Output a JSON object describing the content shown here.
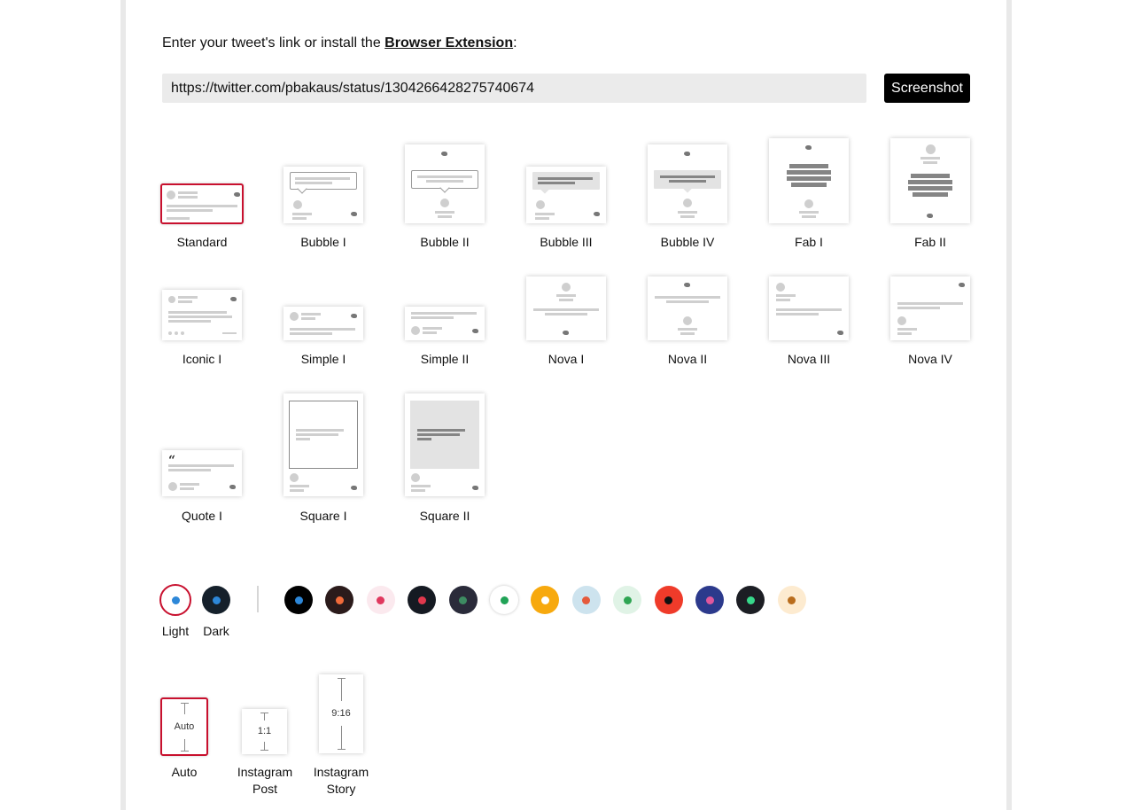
{
  "intro": {
    "prefix": "Enter your tweet's link or install the ",
    "link_text": "Browser Extension",
    "suffix": ":"
  },
  "url_input": {
    "value": "https://twitter.com/pbakaus/status/1304266428275740674",
    "placeholder": ""
  },
  "screenshot_button": "Screenshot",
  "templates": {
    "selected": "Standard",
    "items": [
      {
        "key": "standard",
        "label": "Standard"
      },
      {
        "key": "bubble-1",
        "label": "Bubble I"
      },
      {
        "key": "bubble-2",
        "label": "Bubble II"
      },
      {
        "key": "bubble-3",
        "label": "Bubble III"
      },
      {
        "key": "bubble-4",
        "label": "Bubble IV"
      },
      {
        "key": "fab-1",
        "label": "Fab I"
      },
      {
        "key": "fab-2",
        "label": "Fab II"
      },
      {
        "key": "iconic-1",
        "label": "Iconic I"
      },
      {
        "key": "simple-1",
        "label": "Simple I"
      },
      {
        "key": "simple-2",
        "label": "Simple II"
      },
      {
        "key": "nova-1",
        "label": "Nova I"
      },
      {
        "key": "nova-2",
        "label": "Nova II"
      },
      {
        "key": "nova-3",
        "label": "Nova III"
      },
      {
        "key": "nova-4",
        "label": "Nova IV"
      },
      {
        "key": "quote-1",
        "label": "Quote I"
      },
      {
        "key": "square-1",
        "label": "Square I"
      },
      {
        "key": "square-2",
        "label": "Square II"
      }
    ]
  },
  "themes": {
    "selected": "Light",
    "labeled": [
      {
        "label": "Light",
        "bg": "#ffffff",
        "dot": "#2d87d8"
      },
      {
        "label": "Dark",
        "bg": "#15202b",
        "dot": "#2d87d8"
      }
    ],
    "swatches": [
      {
        "bg": "#000000",
        "dot": "#2d87d8"
      },
      {
        "bg": "#2b1b1b",
        "dot": "#f26b3a"
      },
      {
        "bg": "#fbe9ee",
        "dot": "#e0385e"
      },
      {
        "bg": "#151a22",
        "dot": "#e0384d"
      },
      {
        "bg": "#2a2b3a",
        "dot": "#3d8c62"
      },
      {
        "bg": "#ffffff",
        "dot": "#21a357"
      },
      {
        "bg": "#f7a90e",
        "dot": "#ffffff"
      },
      {
        "bg": "#cde3ee",
        "dot": "#e55a3c"
      },
      {
        "bg": "#e0f3e6",
        "dot": "#2fa553"
      },
      {
        "bg": "#ef3b2a",
        "dot": "#111111"
      },
      {
        "bg": "#2c3a8c",
        "dot": "#e0579c"
      },
      {
        "bg": "#1c1e24",
        "dot": "#37d98b"
      },
      {
        "bg": "#fdebd0",
        "dot": "#b96d1d"
      }
    ]
  },
  "ratios": {
    "selected": "Auto",
    "items": [
      {
        "key": "auto",
        "text": "Auto",
        "label": "Auto",
        "label_line2": ""
      },
      {
        "key": "instagram-post",
        "text": "1:1",
        "label": "Instagram",
        "label_line2": "Post"
      },
      {
        "key": "instagram-story",
        "text": "9:16",
        "label": "Instagram",
        "label_line2": "Story"
      }
    ]
  }
}
